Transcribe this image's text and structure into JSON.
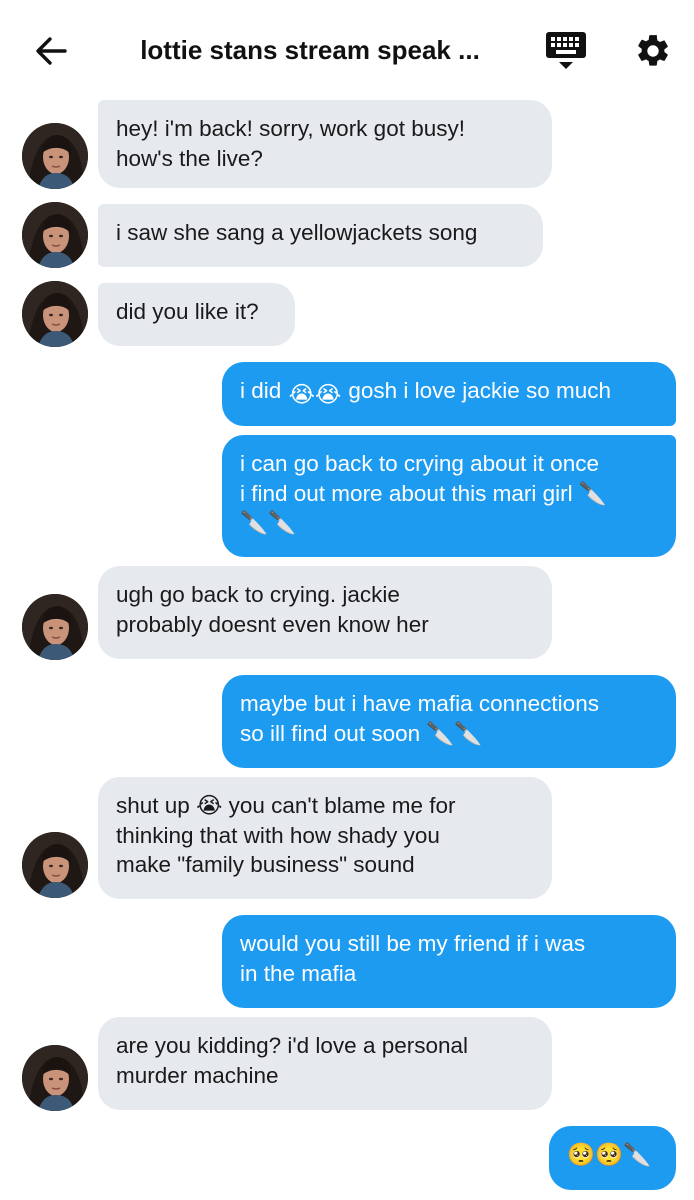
{
  "header": {
    "title": "lottie stans stream speak ...",
    "back_icon": "arrow-left-icon",
    "keyboard_icon": "keyboard-icon",
    "settings_icon": "gear-icon"
  },
  "colors": {
    "incoming_bubble": "#e6e9ee",
    "outgoing_bubble": "#1d9bf0",
    "outgoing_text": "#ffffff",
    "incoming_text": "#1a1a1a"
  },
  "messages": [
    {
      "sender": "them",
      "lines": [
        "hey! i'm back! sorry, work got busy!",
        "how's the live?"
      ]
    },
    {
      "sender": "them",
      "lines": [
        "i saw she sang a yellowjackets song"
      ]
    },
    {
      "sender": "them",
      "lines": [
        "did you like it?"
      ]
    },
    {
      "sender": "me",
      "lines": [
        "i did 😭😭 gosh i love jackie so much"
      ]
    },
    {
      "sender": "me",
      "lines": [
        "i can go back to crying about it once",
        "i find out more about this mari girl 🔪",
        "🔪🔪"
      ]
    },
    {
      "sender": "them",
      "lines": [
        "ugh go back to crying. jackie",
        "probably doesnt even know her"
      ]
    },
    {
      "sender": "me",
      "lines": [
        "maybe but i have mafia connections",
        "so ill find out soon 🔪🔪"
      ]
    },
    {
      "sender": "them",
      "lines": [
        "shut up 😭 you can't blame me for",
        "thinking that with how shady you",
        "make \"family business\" sound"
      ]
    },
    {
      "sender": "me",
      "lines": [
        "would you still be my friend if i was",
        "in the mafia"
      ]
    },
    {
      "sender": "them",
      "lines": [
        "are you kidding? i'd love a personal",
        "murder machine"
      ]
    },
    {
      "sender": "me",
      "lines": [
        "🥺🥺🔪"
      ]
    }
  ]
}
